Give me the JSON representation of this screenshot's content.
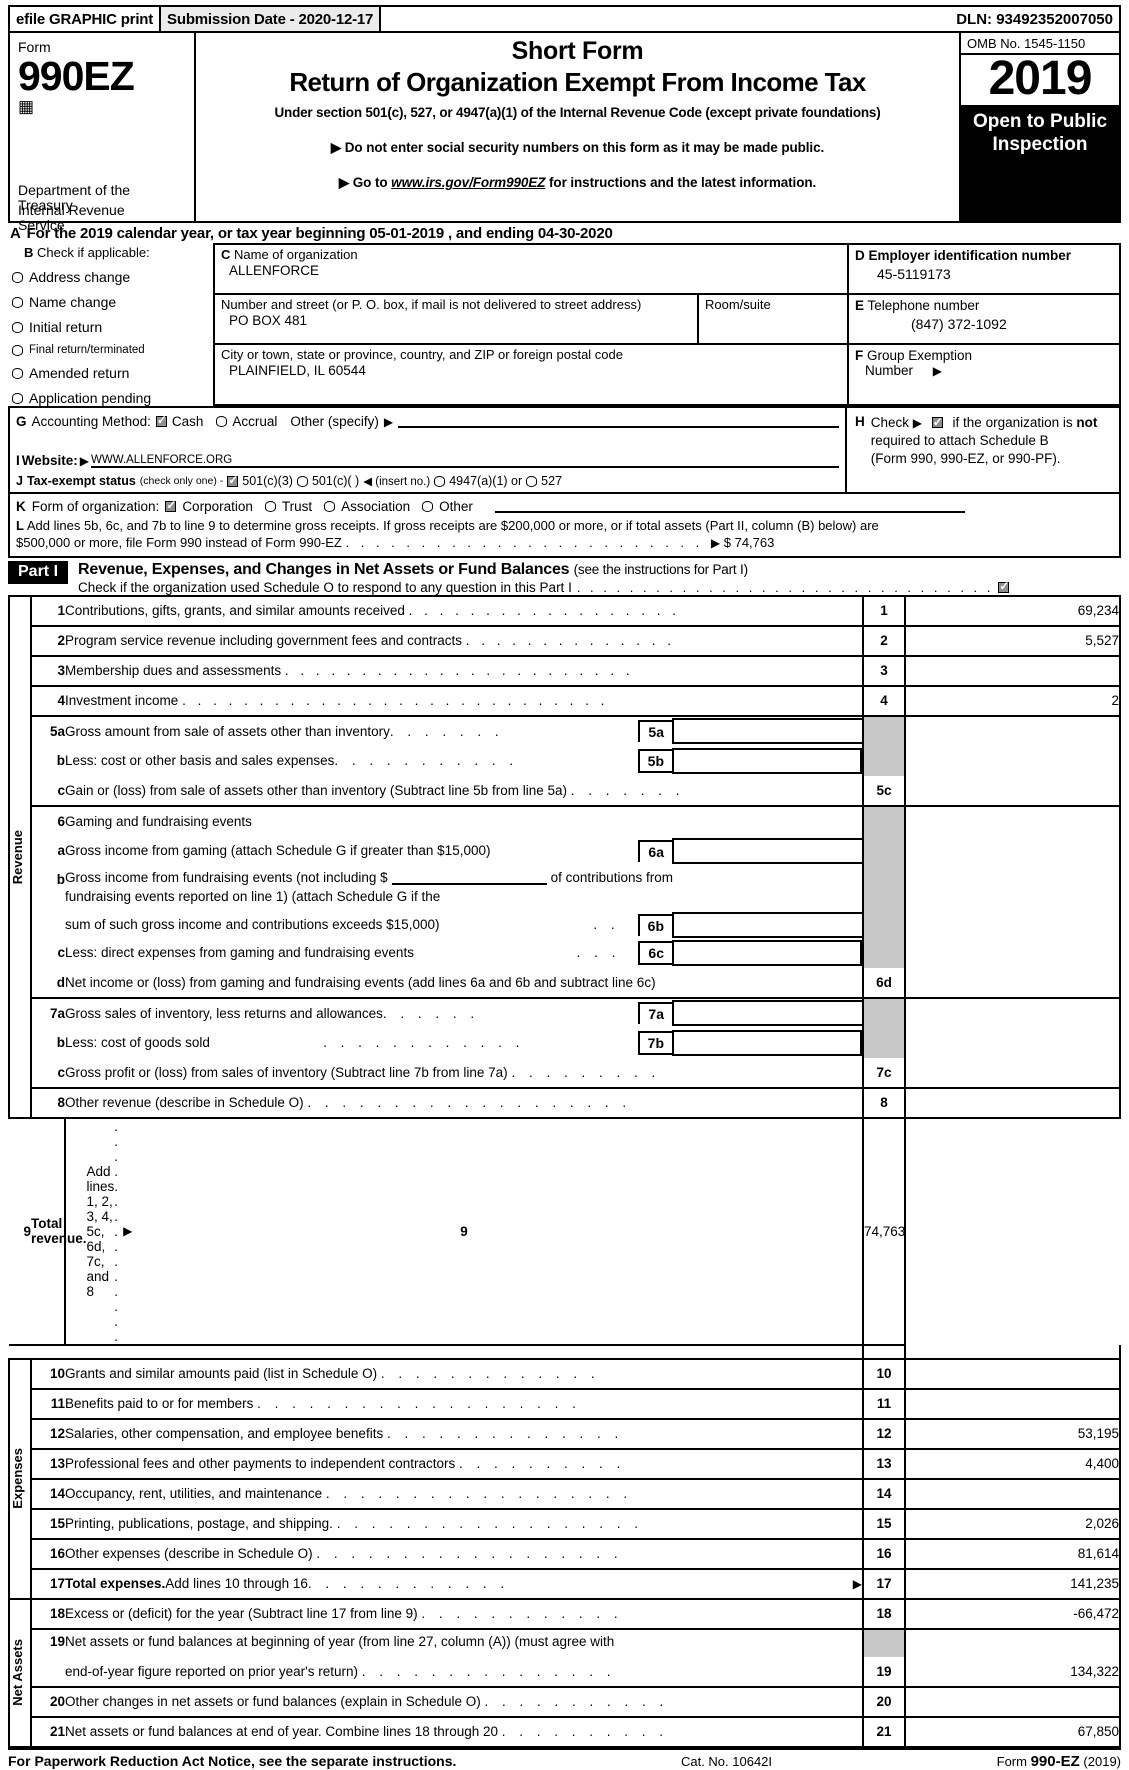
{
  "efile": {
    "graphic_print": "efile GRAPHIC print",
    "submission_date": "Submission Date - 2020-12-17",
    "dln": "DLN: 93492352007050"
  },
  "masthead": {
    "form_label": "Form",
    "form_number": "990EZ",
    "dept_line1": "Department of the",
    "dept_line2": "Treasury",
    "dept_line3": "Internal Revenue",
    "dept_line4": "Service",
    "title1": "Short Form",
    "title2": "Return of Organization Exempt From Income Tax",
    "subtitle": "Under section 501(c), 527, or 4947(a)(1) of the Internal Revenue Code (except private foundations)",
    "bullet1": "▶ Do not enter social security numbers on this form as it may be made public.",
    "bullet2_pre": "▶ Go to ",
    "bullet2_link": "www.irs.gov/Form990EZ",
    "bullet2_post": " for instructions and the latest information.",
    "omb": "OMB No. 1545-1150",
    "year": "2019",
    "open_to_public": "Open to Public Inspection"
  },
  "lineA": {
    "letter": "A",
    "text": "For the 2019 calendar year, or tax year beginning 05-01-2019 , and ending 04-30-2020"
  },
  "sectionB": {
    "letter": "B",
    "heading": "Check if applicable:",
    "options": [
      "Address change",
      "Name change",
      "Initial return",
      "Final return/terminated",
      "Amended return",
      "Application pending"
    ]
  },
  "sectionC": {
    "letter": "C",
    "name_label": "Name of organization",
    "name_value": "ALLENFORCE",
    "street_label": "Number and street (or P. O. box, if mail is not delivered to street address)",
    "street_value": "PO BOX 481",
    "room_label": "Room/suite",
    "room_value": "",
    "city_label": "City or town, state or province, country, and ZIP or foreign postal code",
    "city_value": "PLAINFIELD, IL   60544"
  },
  "sectionD": {
    "letter": "D",
    "label": "Employer identification number",
    "value": "45-5119173"
  },
  "sectionE": {
    "letter": "E",
    "label": "Telephone number",
    "value": "(847) 372-1092"
  },
  "sectionF": {
    "letter": "F",
    "label_line1": "Group Exemption",
    "label_line2": "Number",
    "arrow": "▶",
    "value": ""
  },
  "sectionG": {
    "letter": "G",
    "label": "Accounting Method:",
    "cash": "Cash",
    "cash_checked": true,
    "accrual": "Accrual",
    "accrual_checked": false,
    "other": "Other (specify)",
    "arrow": "▶",
    "other_value": ""
  },
  "sectionH": {
    "letter": "H",
    "check_label": "Check",
    "arrow": "▶",
    "checked": true,
    "text1": "if the organization is ",
    "text1_bold": "not",
    "text2": "required to attach Schedule B",
    "text3": "(Form 990, 990-EZ, or 990-PF)."
  },
  "sectionI": {
    "letter": "I",
    "label": "Website:",
    "arrow": "▶",
    "value": "WWW.ALLENFORCE.ORG"
  },
  "sectionJ": {
    "letter": "J",
    "label": "Tax-exempt status",
    "note": "(check only one) -",
    "opt1": "501(c)(3)",
    "opt1_checked": true,
    "opt2": "501(c)(   )",
    "opt2_checked": false,
    "insert": "◀ (insert no.)",
    "opt3": "4947(a)(1) or",
    "opt3_checked": false,
    "opt4": "527",
    "opt4_checked": false
  },
  "sectionK": {
    "letter": "K",
    "label": "Form of organization:",
    "opt1": "Corporation",
    "opt1_checked": true,
    "opt2": "Trust",
    "opt2_checked": false,
    "opt3": "Association",
    "opt3_checked": false,
    "opt4": "Other",
    "opt4_checked": false,
    "other_value": ""
  },
  "sectionL": {
    "letter": "L",
    "line1": "Add lines 5b, 6c, and 7b to line 9 to determine gross receipts. If gross receipts are $200,000 or more, or if total assets (Part II, column (B) below) are",
    "line2": "$500,000 or more, file Form 990 instead of Form 990-EZ",
    "arrow": "▶",
    "amount": "$ 74,763"
  },
  "partI": {
    "tag": "Part I",
    "title": "Revenue, Expenses, and Changes in Net Assets or Fund Balances",
    "title_note": "(see the instructions for Part I)",
    "check_text": "Check if the organization used Schedule O to respond to any question in this Part I",
    "checked": true
  },
  "sideLabels": {
    "revenue": "Revenue",
    "expenses": "Expenses",
    "net_assets": "Net Assets"
  },
  "rows": [
    {
      "no": "1",
      "sub": "",
      "desc": "Contributions, gifts, grants, and similar amounts received",
      "dots": true,
      "box": "1",
      "amount": "69,234"
    },
    {
      "no": "2",
      "sub": "",
      "desc": "Program service revenue including government fees and contracts",
      "dots": true,
      "box": "2",
      "amount": "5,527"
    },
    {
      "no": "3",
      "sub": "",
      "desc": "Membership dues and assessments",
      "dots": true,
      "box": "3",
      "amount": ""
    },
    {
      "no": "4",
      "sub": "",
      "desc": "Investment income",
      "dots": true,
      "box": "4",
      "amount": "2"
    },
    {
      "no": "5a",
      "sub": "",
      "desc": "Gross amount from sale of assets other than inventory",
      "dots": true,
      "box": "5a",
      "amount": "",
      "inner": true
    },
    {
      "no": "",
      "sub": "b",
      "desc": "Less: cost or other basis and sales expenses",
      "dots": true,
      "box": "5b",
      "amount": "",
      "inner": true
    },
    {
      "no": "",
      "sub": "c",
      "desc": "Gain or (loss) from sale of assets other than inventory (Subtract line 5b from line 5a)",
      "dots": true,
      "box": "5c",
      "amount": ""
    },
    {
      "no": "6",
      "sub": "",
      "desc": "Gaming and fundraising events",
      "dots": false,
      "box": "",
      "amount": ""
    },
    {
      "no": "",
      "sub": "a",
      "desc": "Gross income from gaming (attach Schedule G if greater than $15,000)",
      "dots": false,
      "box": "6a",
      "amount": "",
      "inner": true
    },
    {
      "no": "",
      "sub": "b",
      "desc": "Gross income from fundraising events (not including $",
      "desc2": "of contributions from",
      "desc_l2": "fundraising events reported on line 1) (attach Schedule G if the",
      "desc_l3": "sum of such gross income and contributions exceeds $15,000)",
      "dots": false,
      "box": "6b",
      "amount": "",
      "inner": true
    },
    {
      "no": "",
      "sub": "c",
      "desc": "Less: direct expenses from gaming and fundraising events",
      "dots": false,
      "box": "6c",
      "amount": "",
      "inner": true
    },
    {
      "no": "",
      "sub": "d",
      "desc": "Net income or (loss) from gaming and fundraising events (add lines 6a and 6b and subtract line 6c)",
      "dots": false,
      "box": "6d",
      "amount": ""
    },
    {
      "no": "7a",
      "sub": "",
      "desc": "Gross sales of inventory, less returns and allowances",
      "dots": true,
      "box": "7a",
      "amount": "",
      "inner": true
    },
    {
      "no": "",
      "sub": "b",
      "desc": "Less: cost of goods sold",
      "dots": true,
      "box": "7b",
      "amount": "",
      "inner": true
    },
    {
      "no": "",
      "sub": "c",
      "desc": "Gross profit or (loss) from sales of inventory (Subtract line 7b from line 7a)",
      "dots": true,
      "box": "7c",
      "amount": ""
    },
    {
      "no": "8",
      "sub": "",
      "desc": "Other revenue (describe in Schedule O)",
      "dots": true,
      "box": "8",
      "amount": ""
    },
    {
      "no": "9",
      "sub": "",
      "desc_bold": "Total revenue.",
      "desc": " Add lines 1, 2, 3, 4, 5c, 6d, 7c, and 8",
      "dots": true,
      "arrow": "▶",
      "box": "9",
      "amount": "74,763"
    },
    {
      "no": "10",
      "sub": "",
      "desc": "Grants and similar amounts paid (list in Schedule O)",
      "dots": true,
      "box": "10",
      "amount": ""
    },
    {
      "no": "11",
      "sub": "",
      "desc": "Benefits paid to or for members",
      "dots": true,
      "box": "11",
      "amount": ""
    },
    {
      "no": "12",
      "sub": "",
      "desc": "Salaries, other compensation, and employee benefits",
      "dots": true,
      "box": "12",
      "amount": "53,195"
    },
    {
      "no": "13",
      "sub": "",
      "desc": "Professional fees and other payments to independent contractors",
      "dots": true,
      "box": "13",
      "amount": "4,400"
    },
    {
      "no": "14",
      "sub": "",
      "desc": "Occupancy, rent, utilities, and maintenance",
      "dots": true,
      "box": "14",
      "amount": ""
    },
    {
      "no": "15",
      "sub": "",
      "desc": "Printing, publications, postage, and shipping.",
      "dots": true,
      "box": "15",
      "amount": "2,026"
    },
    {
      "no": "16",
      "sub": "",
      "desc": "Other expenses (describe in Schedule O)",
      "dots": true,
      "box": "16",
      "amount": "81,614"
    },
    {
      "no": "17",
      "sub": "",
      "desc_bold": "Total expenses.",
      "desc": " Add lines 10 through 16",
      "dots": true,
      "arrow": "▶",
      "box": "17",
      "amount": "141,235"
    },
    {
      "no": "18",
      "sub": "",
      "desc": "Excess or (deficit) for the year (Subtract line 17 from line 9)",
      "dots": true,
      "box": "18",
      "amount": "-66,472"
    },
    {
      "no": "19",
      "sub": "",
      "desc": "Net assets or fund balances at beginning of year (from line 27, column (A)) (must agree with",
      "desc_l2": "end-of-year figure reported on prior year's return)",
      "dots": true,
      "box": "19",
      "amount": "134,322"
    },
    {
      "no": "20",
      "sub": "",
      "desc": "Other changes in net assets or fund balances (explain in Schedule O)",
      "dots": true,
      "box": "20",
      "amount": ""
    },
    {
      "no": "21",
      "sub": "",
      "desc": "Net assets or fund balances at end of year. Combine lines 18 through 20",
      "dots": true,
      "box": "21",
      "amount": "67,850"
    }
  ],
  "footer": {
    "notice": "For Paperwork Reduction Act Notice, see the separate instructions.",
    "cat_no": "Cat. No. 10642I",
    "form_pre": "Form ",
    "form_bold": "990-EZ",
    "form_year": "(2019)"
  }
}
